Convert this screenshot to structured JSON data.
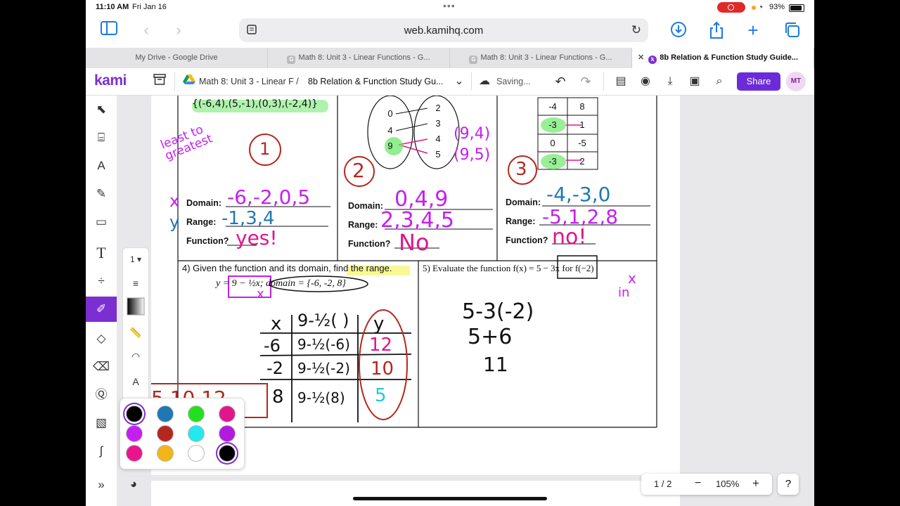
{
  "status_bar": {
    "time": "11:10 AM",
    "date": "Fri Jan 16",
    "battery": "93%"
  },
  "browser": {
    "url": "web.kamihq.com"
  },
  "tabs": [
    {
      "label": "My Drive - Google Drive"
    },
    {
      "label": "Math 8: Unit 3 - Linear Functions - G..."
    },
    {
      "label": "Math 8: Unit 3 - Linear Functions - G..."
    },
    {
      "label": "8b Relation & Function Study Guide..."
    }
  ],
  "kami": {
    "logo": "kami",
    "breadcrumb_folder": "Math 8: Unit 3 - Linear F /",
    "doc_title": "8b  Relation & Function Study Gu...",
    "saving": "Saving...",
    "share": "Share",
    "avatar": "MT"
  },
  "tools": {
    "page_number": "1"
  },
  "colors": {
    "accent": "#7b2fd1",
    "swatches": [
      "#000000",
      "#1f78b4",
      "#22e01f",
      "#e0168c",
      "#c51ff0",
      "#b3281e",
      "#22e8f0",
      "#b21ae0",
      "#e8168e",
      "#f2b51a",
      "#ffffff",
      "#000000"
    ]
  },
  "worksheet": {
    "p1": {
      "set": "{(-6,4),(5,-1),(0,3),(-2,4)}",
      "domain_label": "Domain:",
      "range_label": "Range:",
      "function_label": "Function?",
      "circled_number": "1",
      "note": "least to greatest",
      "domain_answer": "-6,-2,0,5",
      "range_answer": "-1,3,4",
      "function_answer": "yes!",
      "x_mark": "x",
      "y_mark": "y"
    },
    "p2": {
      "left_values": [
        "0",
        "4",
        "9"
      ],
      "right_values": [
        "2",
        "3",
        "4",
        "5"
      ],
      "circled_number": "2",
      "pairs_note": "(9,4)\n(9,5)",
      "domain_label": "Domain:",
      "range_label": "Range:",
      "function_label": "Function?",
      "domain_answer": "0,4,9",
      "range_answer": "2,3,4,5",
      "function_answer": "No"
    },
    "p3": {
      "table": [
        [
          "-4",
          "8"
        ],
        [
          "-3",
          "1"
        ],
        [
          "0",
          "-5"
        ],
        [
          "-3",
          "2"
        ]
      ],
      "circled_number": "3",
      "domain_label": "Domain:",
      "range_label": "Range:",
      "function_label": "Function?",
      "domain_answer": "-4,-3,0",
      "range_answer": "-5,1,2,8",
      "function_answer": "no!"
    },
    "p4": {
      "prompt_a": "4)  Given the function and its domain, ",
      "prompt_b": "find the range.",
      "equation": "y = 9 − ½x",
      "domain_text": "; domain = {-6, -2, 8}",
      "x_mark": "x",
      "table_header": [
        "x",
        "9-½( )",
        "y"
      ],
      "table_rows": [
        [
          "-6",
          "9-½(-6)",
          "12"
        ],
        [
          "-2",
          "9-½(-2)",
          "10"
        ],
        [
          "8",
          "9-½(8)",
          "5"
        ]
      ],
      "range_answer": "5,10,12"
    },
    "p5": {
      "prompt": "5)  Evaluate the function f(x) = 5 − 3x for f(−2)",
      "x_note": "x",
      "in_note": "in",
      "work": [
        "5-3(-2)",
        "5+6",
        "11"
      ]
    }
  },
  "zoom": {
    "page": "1 / 2",
    "level": "105%",
    "minus": "−",
    "plus": "+",
    "help": "?"
  }
}
